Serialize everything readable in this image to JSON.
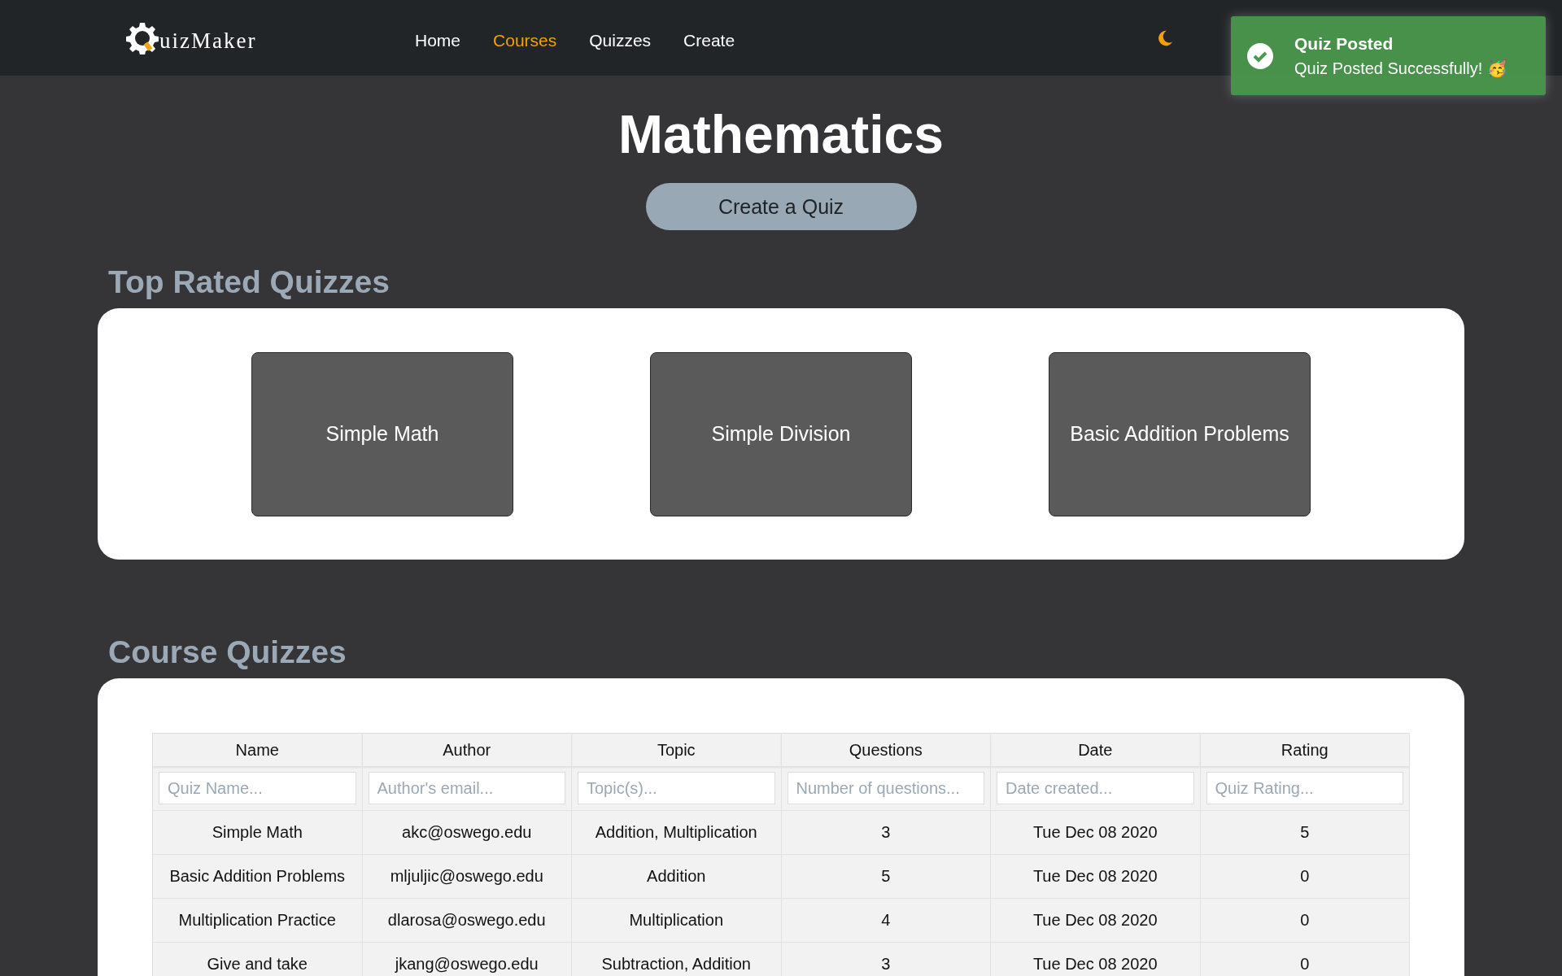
{
  "navbar": {
    "logo_text": "uizMaker",
    "links": [
      {
        "label": "Home",
        "selected": false
      },
      {
        "label": "Courses",
        "selected": true
      },
      {
        "label": "Quizzes",
        "selected": false
      },
      {
        "label": "Create",
        "selected": false
      }
    ]
  },
  "toast": {
    "title": "Quiz Posted",
    "message": "Quiz Posted Successfully! 🥳"
  },
  "page_title": "Mathematics",
  "create_button": "Create a Quiz",
  "top_rated": {
    "heading": "Top Rated Quizzes",
    "quizzes": [
      "Simple Math",
      "Simple Division",
      "Basic Addition Problems"
    ]
  },
  "course_quizzes": {
    "heading": "Course Quizzes",
    "table": {
      "columns": [
        {
          "label": "Name",
          "placeholder": "Quiz Name..."
        },
        {
          "label": "Author",
          "placeholder": "Author's email..."
        },
        {
          "label": "Topic",
          "placeholder": "Topic(s)..."
        },
        {
          "label": "Questions",
          "placeholder": "Number of questions..."
        },
        {
          "label": "Date",
          "placeholder": "Date created..."
        },
        {
          "label": "Rating",
          "placeholder": "Quiz Rating..."
        }
      ],
      "rows": [
        [
          "Simple Math",
          "akc@oswego.edu",
          "Addition, Multiplication",
          "3",
          "Tue Dec 08 2020",
          "5"
        ],
        [
          "Basic Addition Problems",
          "mljuljic@oswego.edu",
          "Addition",
          "5",
          "Tue Dec 08 2020",
          "0"
        ],
        [
          "Multiplication Practice",
          "dlarosa@oswego.edu",
          "Multiplication",
          "4",
          "Tue Dec 08 2020",
          "0"
        ],
        [
          "Give and take",
          "jkang@oswego.edu",
          "Subtraction, Addition",
          "3",
          "Tue Dec 08 2020",
          "0"
        ]
      ]
    }
  }
}
